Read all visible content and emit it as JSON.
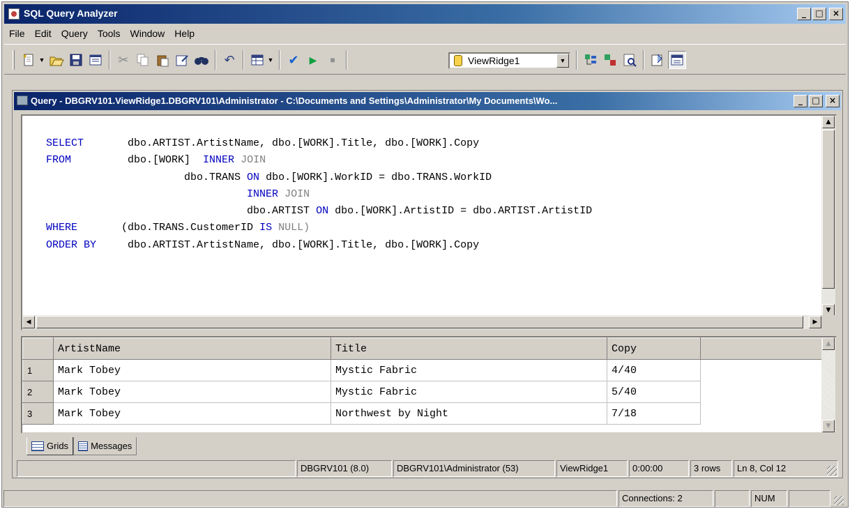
{
  "app": {
    "title": "SQL Query Analyzer",
    "caption_buttons": [
      "_",
      "□",
      "×"
    ]
  },
  "menu": [
    "File",
    "Edit",
    "Query",
    "Tools",
    "Window",
    "Help"
  ],
  "toolbar": {
    "icons": [
      "new-query-icon",
      "open-icon",
      "save-icon",
      "load-script-icon",
      "cut-icon",
      "copy-icon",
      "paste-icon",
      "clear-window-icon",
      "find-icon",
      "undo-icon",
      "results-mode-icon",
      "parse-icon",
      "execute-icon",
      "stop-icon",
      "object-browser-icon",
      "object-search-icon",
      "show-plan-icon",
      "properties-icon",
      "results-pane-icon"
    ],
    "database": "ViewRidge1"
  },
  "query_window": {
    "title": "Query - DBGRV101.ViewRidge1.DBGRV101\\Administrator - C:\\Documents and Settings\\Administrator\\My Documents\\Wo...",
    "sql_lines": [
      [
        {
          "t": "SELECT",
          "c": "kw"
        },
        {
          "t": "       dbo.ARTIST.ArtistName, dbo.[WORK].Title, dbo.[WORK].Copy",
          "c": ""
        }
      ],
      [
        {
          "t": "FROM",
          "c": "kw"
        },
        {
          "t": "         dbo.[WORK]  ",
          "c": ""
        },
        {
          "t": "INNER",
          "c": "kw"
        },
        {
          "t": " JOIN",
          "c": "gr"
        }
      ],
      [
        {
          "t": "                      dbo.TRANS ",
          "c": ""
        },
        {
          "t": "ON",
          "c": "kw"
        },
        {
          "t": " dbo.[WORK].WorkID = dbo.TRANS.WorkID",
          "c": ""
        }
      ],
      [
        {
          "t": "                                ",
          "c": ""
        },
        {
          "t": "INNER",
          "c": "kw"
        },
        {
          "t": " JOIN",
          "c": "gr"
        }
      ],
      [
        {
          "t": "                                dbo.ARTIST ",
          "c": ""
        },
        {
          "t": "ON",
          "c": "kw"
        },
        {
          "t": " dbo.[WORK].ArtistID = dbo.ARTIST.ArtistID",
          "c": ""
        }
      ],
      [
        {
          "t": "WHERE",
          "c": "kw"
        },
        {
          "t": "       (dbo.TRANS.CustomerID ",
          "c": ""
        },
        {
          "t": "IS",
          "c": "kw"
        },
        {
          "t": " NULL)",
          "c": "gr"
        }
      ],
      [
        {
          "t": "ORDER BY",
          "c": "kw"
        },
        {
          "t": "     dbo.ARTIST.ArtistName, dbo.[WORK].Title, dbo.[WORK].Copy",
          "c": ""
        }
      ]
    ],
    "results": {
      "columns": [
        "ArtistName",
        "Title",
        "Copy"
      ],
      "rows": [
        {
          "n": "1",
          "cells": [
            "Mark Tobey",
            "Mystic Fabric",
            "4/40"
          ]
        },
        {
          "n": "2",
          "cells": [
            "Mark Tobey",
            "Mystic Fabric",
            "5/40"
          ]
        },
        {
          "n": "3",
          "cells": [
            "Mark Tobey",
            "Northwest by Night",
            "7/18"
          ]
        }
      ]
    },
    "tabs": [
      "Grids",
      "Messages"
    ],
    "status": {
      "server": "DBGRV101 (8.0)",
      "user": "DBGRV101\\Administrator (53)",
      "database": "ViewRidge1",
      "time": "0:00:00",
      "rows": "3 rows",
      "position": "Ln 8, Col 12"
    }
  },
  "statusbar": {
    "connections": "Connections: 2",
    "num": "NUM"
  }
}
